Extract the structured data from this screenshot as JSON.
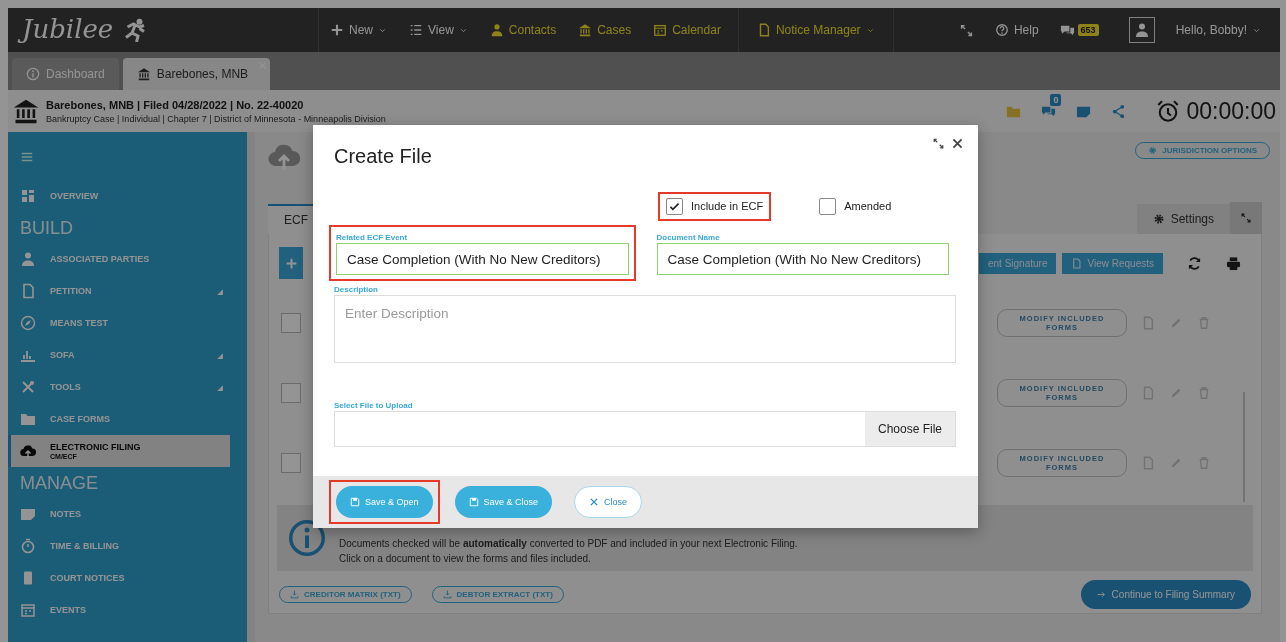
{
  "nav": {
    "logo": "Jubilee",
    "menu": [
      {
        "label": "New",
        "accent": false,
        "dropdown": true
      },
      {
        "label": "View",
        "accent": false,
        "dropdown": true
      },
      {
        "label": "Contacts",
        "accent": true,
        "dropdown": false
      },
      {
        "label": "Cases",
        "accent": true,
        "dropdown": false
      },
      {
        "label": "Calendar",
        "accent": true,
        "dropdown": false
      },
      {
        "label": "Notice Manager",
        "accent": true,
        "dropdown": true
      }
    ],
    "help": "Help",
    "chat_badge": "653",
    "greeting": "Hello, Bobby!"
  },
  "tabs": [
    {
      "label": "Dashboard",
      "selected": false,
      "closable": false
    },
    {
      "label": "Barebones, MNB",
      "selected": true,
      "closable": true
    }
  ],
  "case_header": {
    "title": "Barebones, MNB | Filed 04/28/2022 | No. 22-40020",
    "details": "Bankruptcy Case | Individual | Chapter 7 | District of Minnesota - Minneapolis Division",
    "messages_badge": "0",
    "timer": "00:00:00"
  },
  "sidebar": {
    "items": [
      {
        "kind": "item",
        "label": "OVERVIEW",
        "expandable": false,
        "selected": false
      },
      {
        "kind": "heading",
        "label": "BUILD"
      },
      {
        "kind": "item",
        "label": "ASSOCIATED PARTIES",
        "expandable": false,
        "selected": false
      },
      {
        "kind": "item",
        "label": "PETITION",
        "expandable": true,
        "selected": false
      },
      {
        "kind": "item",
        "label": "MEANS TEST",
        "expandable": false,
        "selected": false
      },
      {
        "kind": "item",
        "label": "SOFA",
        "expandable": true,
        "selected": false
      },
      {
        "kind": "item",
        "label": "TOOLS",
        "expandable": true,
        "selected": false
      },
      {
        "kind": "item",
        "label": "CASE FORMS",
        "expandable": false,
        "selected": false
      },
      {
        "kind": "item",
        "label": "ELECTRONIC FILING",
        "sublabel": "CM/ECF",
        "expandable": false,
        "selected": true
      },
      {
        "kind": "heading",
        "label": "MANAGE"
      },
      {
        "kind": "item",
        "label": "NOTES",
        "expandable": false,
        "selected": false
      },
      {
        "kind": "item",
        "label": "TIME & BILLING",
        "expandable": false,
        "selected": false
      },
      {
        "kind": "item",
        "label": "COURT NOTICES",
        "expandable": false,
        "selected": false
      },
      {
        "kind": "item",
        "label": "EVENTS",
        "expandable": false,
        "selected": false
      }
    ]
  },
  "main": {
    "jurisdiction_button": "JURISDICTION OPTIONS",
    "card_tabs": [
      {
        "label": "ECF",
        "selected": true
      },
      {
        "label": "Settings",
        "selected": false
      }
    ],
    "toolbar_buttons": [
      "ent Signature",
      "View Requests"
    ],
    "rows": [
      {
        "checked": false,
        "action": "MODIFY INCLUDED FORMS"
      },
      {
        "checked": false,
        "action": "MODIFY INCLUDED FORMS"
      },
      {
        "checked": false,
        "action": "MODIFY INCLUDED FORMS"
      }
    ],
    "info_lines": [
      "Documents checked will be **automatically** converted to PDF and included in your next Electronic Filing.",
      "Click on a document to view the forms and files included."
    ],
    "downloads": [
      "CREDITOR MATRIX (TXT)",
      "DEBTOR EXTRACT (TXT)"
    ],
    "continue_button": "Continue to Filing Summary"
  },
  "modal": {
    "title": "Create File",
    "checkboxes": [
      {
        "label": "Include in ECF",
        "checked": true,
        "highlighted": true
      },
      {
        "label": "Amended",
        "checked": false,
        "highlighted": false
      }
    ],
    "fields": [
      {
        "label": "Related ECF Event",
        "value": "Case Completion (With No New Creditors)",
        "highlighted": true
      },
      {
        "label": "Document Name",
        "value": "Case Completion (With No New Creditors)",
        "highlighted": false
      }
    ],
    "description": {
      "label": "Description",
      "placeholder": "Enter Description"
    },
    "upload": {
      "label": "Select File to Upload",
      "button": "Choose File"
    },
    "buttons": [
      {
        "label": "Save & Open",
        "kind": "primary",
        "highlighted": true
      },
      {
        "label": "Save & Close",
        "kind": "primary",
        "highlighted": false
      },
      {
        "label": "Close",
        "kind": "outline",
        "highlighted": false
      }
    ]
  }
}
